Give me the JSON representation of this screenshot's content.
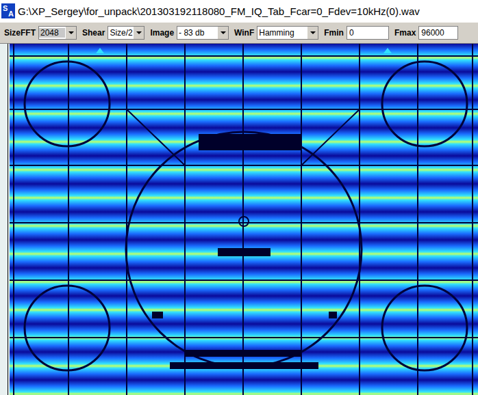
{
  "window": {
    "title": "G:\\XP_Sergey\\for_unpack\\201303192118080_FM_IQ_Tab_Fcar=0_Fdev=10kHz(0).wav",
    "logo": {
      "top": "S",
      "bottom": "A"
    }
  },
  "toolbar": [
    {
      "label": "SizeFFT",
      "kind": "select",
      "value": "2048"
    },
    {
      "label": "Shear",
      "kind": "select",
      "value": "Size/2"
    },
    {
      "label": "Image",
      "kind": "select",
      "value": "- 83 db"
    },
    {
      "label": "WinF",
      "kind": "select",
      "value": "Hamming"
    },
    {
      "label": "Fmin",
      "kind": "input",
      "value": "0"
    },
    {
      "label": "Fmax",
      "kind": "input",
      "value": "96000"
    }
  ]
}
